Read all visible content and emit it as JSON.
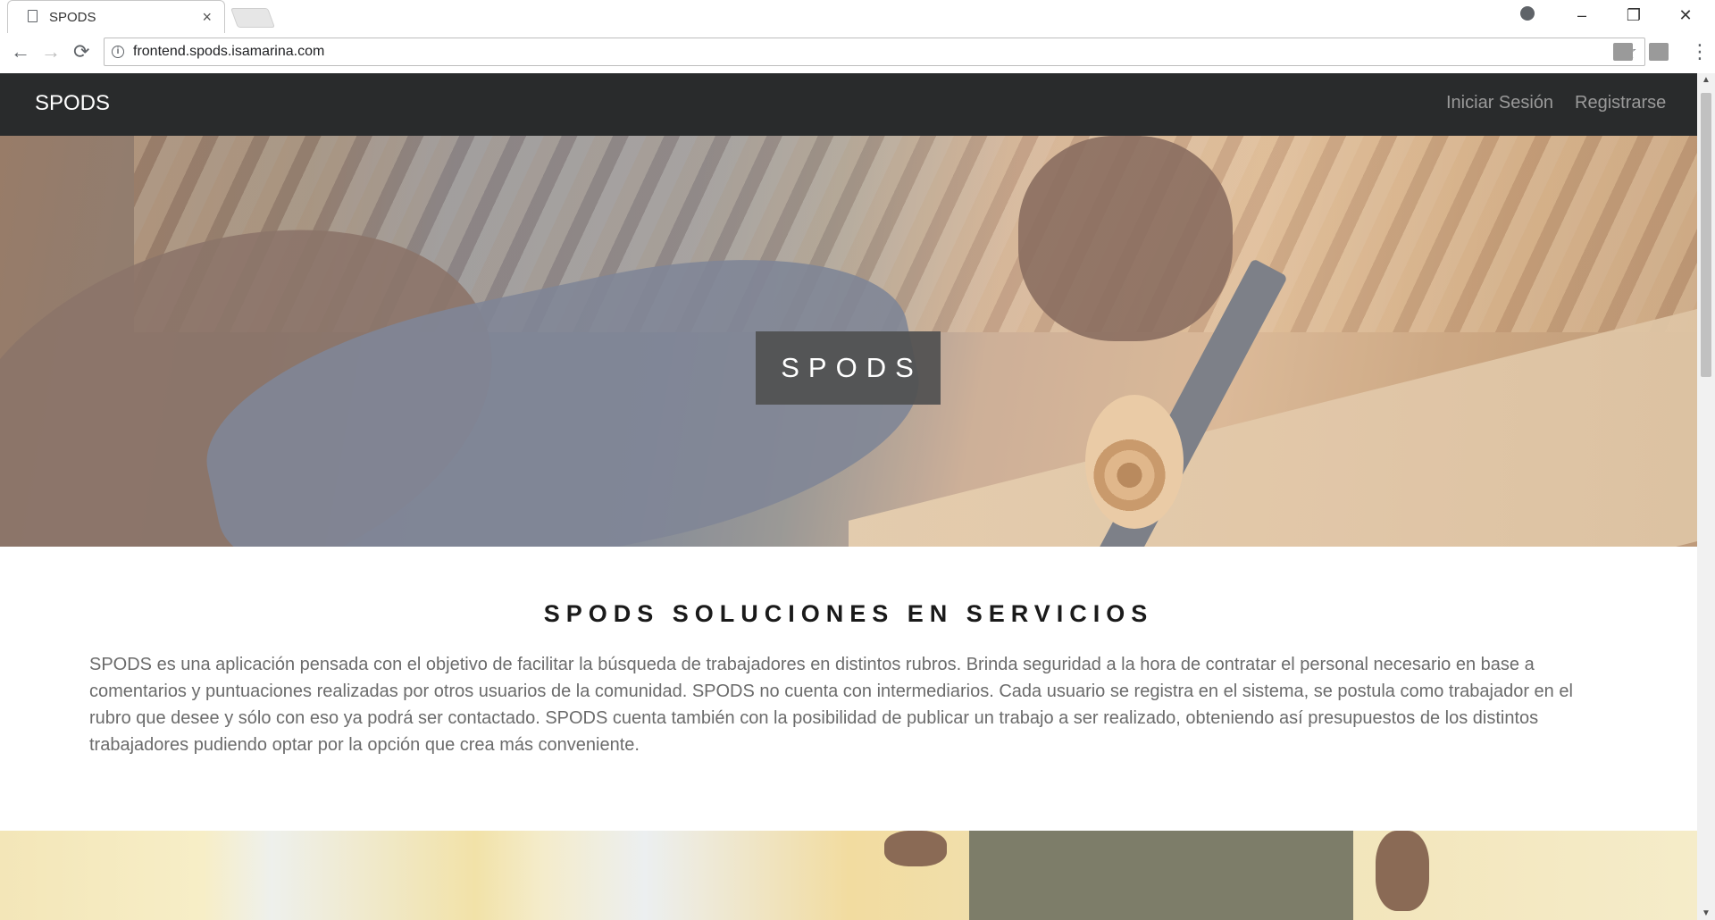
{
  "browser": {
    "tab_title": "SPODS",
    "tab_close": "×",
    "url": "frontend.spods.isamarina.com",
    "window_controls": {
      "minimize": "–",
      "maximize": "❐",
      "close": "✕"
    },
    "nav": {
      "back": "←",
      "forward": "→",
      "reload": "⟳",
      "star": "☆",
      "menu": "⋮",
      "info": "i"
    },
    "icons": [
      "document-icon",
      "profile-icon",
      "info-icon",
      "star-icon",
      "extension-icon",
      "menu-icon"
    ]
  },
  "navbar": {
    "brand": "SPODS",
    "links": [
      "Iniciar Sesión",
      "Registrarse"
    ]
  },
  "hero": {
    "title": "SPODS"
  },
  "about": {
    "title": "SPODS SOLUCIONES EN SERVICIOS",
    "body": "SPODS es una aplicación pensada con el objetivo de facilitar la búsqueda de trabajadores en distintos rubros. Brinda seguridad a la hora de contratar el personal necesario en base a comentarios y puntuaciones realizadas por otros usuarios de la comunidad. SPODS no cuenta con intermediarios. Cada usuario se registra en el sistema, se postula como trabajador en el rubro que desee y sólo con eso ya podrá ser contactado. SPODS cuenta también con la posibilidad de publicar un trabajo a ser realizado, obteniendo así presupuestos de los distintos trabajadores pudiendo optar por la opción que crea más conveniente."
  },
  "colors": {
    "navbar_bg": "#292b2c",
    "nav_link": "#9a9a9a",
    "hero_title_bg": "#505050",
    "body_text": "#6b6b6b"
  }
}
